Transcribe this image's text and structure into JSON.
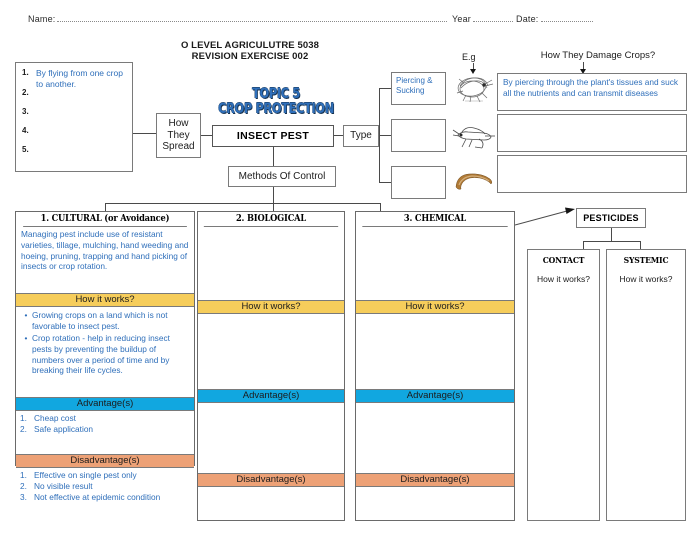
{
  "header": {
    "name_label": "Name:",
    "year_label": "Year",
    "date_label": "Date:",
    "title_line1": "O LEVEL AGRICULUTRE 5038",
    "title_line2": "REVISION EXERCISE 002"
  },
  "topic": {
    "line1": "TOPIC 5",
    "line2": "CROP PROTECTION",
    "color": "#2f6fba"
  },
  "center": {
    "insect_pest": "INSECT PEST",
    "how_they_spread": "How\nThey\nSpread",
    "how_they_spread_lines": [
      "How",
      "They",
      "Spread"
    ],
    "type": "Type",
    "methods_of_control": "Methods Of Control"
  },
  "spread_list": {
    "items": [
      {
        "n": "1.",
        "text": "By flying from one crop to another."
      },
      {
        "n": "2.",
        "text": ""
      },
      {
        "n": "3.",
        "text": ""
      },
      {
        "n": "4.",
        "text": ""
      },
      {
        "n": "5.",
        "text": ""
      }
    ]
  },
  "types": {
    "eg_label": "E.g",
    "damage_heading": "How They Damage Crops?",
    "rows": [
      {
        "type_name": "Piercing & Sucking",
        "insect": "aphid-illustration",
        "damage": "By piercing through the plant's tissues and suck all the nutrients and can transmit diseases"
      },
      {
        "type_name": "",
        "insect": "grasshopper-illustration",
        "damage": ""
      },
      {
        "type_name": "",
        "insect": "caterpillar-illustration",
        "damage": ""
      }
    ]
  },
  "methods": {
    "columns": [
      {
        "heading": "1. CULTURAL (or Avoidance)",
        "intro": "Managing pest include use of resistant varieties, tillage, mulching, hand weeding and hoeing, pruning, trapping and hand picking of insects or crop rotation.",
        "how_label": "How it works?",
        "how_bullets": [
          "Growing crops on a land which is not favorable to insect pest.",
          "Crop rotation - help in reducing insect pests by preventing the buildup of numbers over a period of time and by breaking their life cycles."
        ],
        "advantage_label": "Advantage(s)",
        "advantages": [
          {
            "n": "1.",
            "text": "Cheap cost"
          },
          {
            "n": "2.",
            "text": "Safe application"
          }
        ],
        "disadvantage_label": "Disadvantage(s)",
        "disadvantages": [
          {
            "n": "1.",
            "text": "Effective on single pest only"
          },
          {
            "n": "2.",
            "text": "No visible result"
          },
          {
            "n": "3.",
            "text": " Not effective at epidemic condition"
          }
        ]
      },
      {
        "heading": "2. BIOLOGICAL",
        "intro": "",
        "how_label": "How it works?",
        "advantage_label": "Advantage(s)",
        "disadvantage_label": "Disadvantage(s)"
      },
      {
        "heading": "3. CHEMICAL",
        "intro": "",
        "how_label": "How it works?",
        "advantage_label": "Advantage(s)",
        "disadvantage_label": "Disadvantage(s)"
      }
    ]
  },
  "pesticides": {
    "title": "PESTICIDES",
    "branches": [
      {
        "heading": "CONTACT",
        "question": "How it works?"
      },
      {
        "heading": "SYSTEMIC",
        "question": "How it works?"
      }
    ]
  },
  "colors": {
    "band_yellow": "#f6cd5b",
    "band_blue": "#11a7e0",
    "band_orange": "#eda176",
    "text_blue": "#2f6fba",
    "border": "#7a7a7a"
  }
}
